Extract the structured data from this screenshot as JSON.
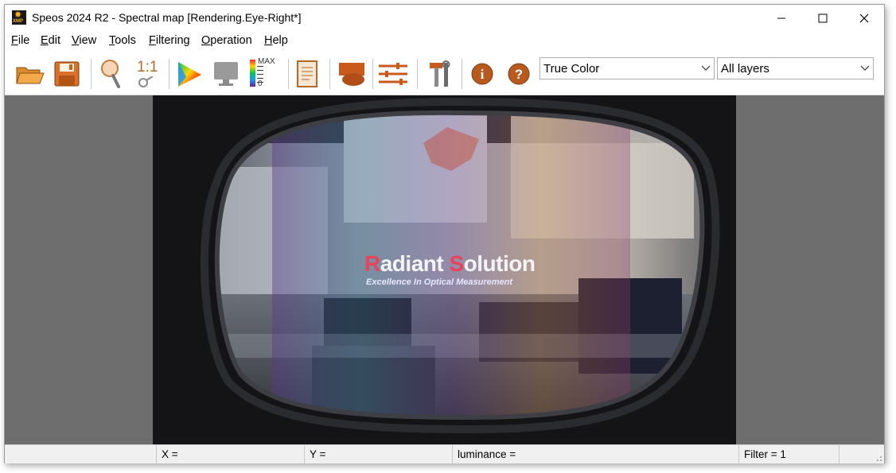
{
  "window": {
    "title": "Speos 2024 R2 - Spectral map [Rendering.Eye-Right*]",
    "icon_label": "XMP"
  },
  "menu": [
    "File",
    "Edit",
    "View",
    "Tools",
    "Filtering",
    "Operation",
    "Help"
  ],
  "toolbar": {
    "buttons": [
      "open-folder-icon",
      "save-icon",
      "magnifier-icon",
      "zoom-1to1-icon",
      "color-gamut-icon",
      "monitor-icon",
      "max-scale-icon",
      "report-icon",
      "layer-shape-icon",
      "settings-sliders-icon",
      "tools-icon",
      "info-icon",
      "help-icon"
    ],
    "zoom_label": "1:1",
    "max_label": "MAX",
    "min_label": "0",
    "display_mode": "True Color",
    "layers": "All layers"
  },
  "render": {
    "brand_r": "R",
    "brand_rest1": "adiant ",
    "brand_s": "S",
    "brand_rest2": "olution",
    "tagline": "Excellence In Optical Measurement"
  },
  "status": {
    "x_label": "X =",
    "y_label": "Y =",
    "luminance_label": "luminance =",
    "filter_label": "Filter = 1"
  },
  "colors": {
    "accent_orange": "#e07a1f",
    "viewport_bg": "#6e6e6e",
    "brand_red": "#e8435a",
    "brand_white": "#f4f4f8"
  }
}
